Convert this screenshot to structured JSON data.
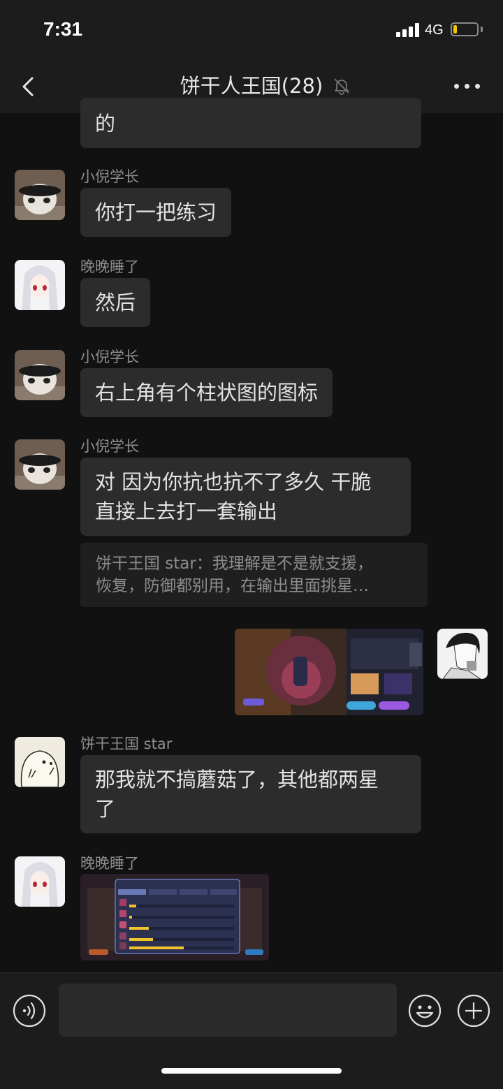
{
  "status_bar": {
    "time": "7:31",
    "network": "4G",
    "battery_level": 0.15,
    "battery_color": "#f5c400"
  },
  "nav": {
    "title": "饼干人王国(28)",
    "back_icon": "chevron-left-icon",
    "mute_icon": "bell-off-icon",
    "more_icon": "more-dots-icon"
  },
  "messages": [
    {
      "type": "text",
      "continued": true,
      "text": "的"
    },
    {
      "type": "text",
      "sender": "小倪学长",
      "avatar": "panda-avatar",
      "text": "你打一把练习"
    },
    {
      "type": "text",
      "sender": "晚晚睡了",
      "avatar": "anime-girl-avatar",
      "text": "然后"
    },
    {
      "type": "text",
      "sender": "小倪学长",
      "avatar": "panda-avatar",
      "text": "右上角有个柱状图的图标"
    },
    {
      "type": "text",
      "sender": "小倪学长",
      "avatar": "panda-avatar",
      "lines": [
        "对 因为你抗也抗不了多久 干脆",
        "直接上去打一套输出"
      ],
      "quote": [
        "饼干王国 star：我理解是不是就支援，",
        "恢复，防御都别用，在输出里面挑星…"
      ]
    },
    {
      "type": "image",
      "self": true,
      "avatar": "manga-man-avatar",
      "content": "game-screenshot"
    },
    {
      "type": "text",
      "sender": "饼干王国 star",
      "avatar": "cartoon-seal-avatar",
      "lines": [
        "那我就不搞蘑菇了，其他都两星",
        "了"
      ]
    },
    {
      "type": "image",
      "sender": "晚晚睡了",
      "avatar": "anime-girl-avatar",
      "content": "battle-report-screenshot"
    }
  ],
  "input_bar": {
    "voice_icon": "voice-icon",
    "emoji_icon": "emoji-icon",
    "plus_icon": "plus-icon"
  }
}
